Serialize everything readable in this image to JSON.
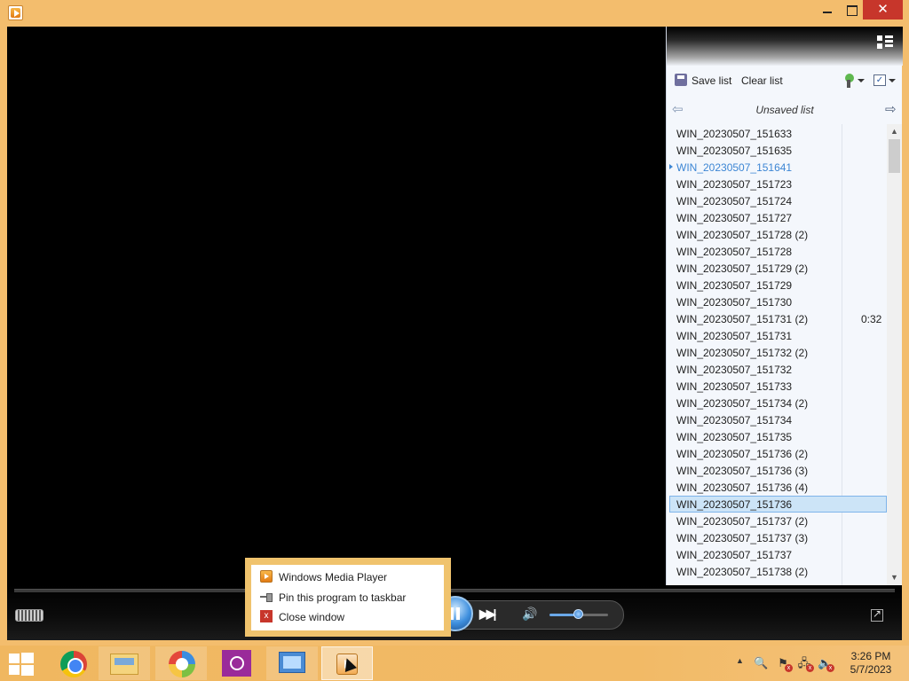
{
  "window": {
    "title": "",
    "icon": "windows-media-player-icon",
    "controls": {
      "minimize_icon": "minimize-icon",
      "maximize_icon": "maximize-icon",
      "close_glyph": "✕"
    }
  },
  "playlist": {
    "toolbar": {
      "save_label": "Save list",
      "clear_label": "Clear list"
    },
    "title": "Unsaved list",
    "nav": {
      "back_glyph": "⇦",
      "forward_glyph": "⇨"
    },
    "items": [
      {
        "name": "WIN_20230507_151633",
        "duration": ""
      },
      {
        "name": "WIN_20230507_151635",
        "duration": ""
      },
      {
        "name": "WIN_20230507_151641",
        "duration": "",
        "playing": true
      },
      {
        "name": "WIN_20230507_151723",
        "duration": ""
      },
      {
        "name": "WIN_20230507_151724",
        "duration": ""
      },
      {
        "name": "WIN_20230507_151727",
        "duration": ""
      },
      {
        "name": "WIN_20230507_151728 (2)",
        "duration": ""
      },
      {
        "name": "WIN_20230507_151728",
        "duration": ""
      },
      {
        "name": "WIN_20230507_151729 (2)",
        "duration": ""
      },
      {
        "name": "WIN_20230507_151729",
        "duration": ""
      },
      {
        "name": "WIN_20230507_151730",
        "duration": ""
      },
      {
        "name": "WIN_20230507_151731 (2)",
        "duration": "0:32"
      },
      {
        "name": "WIN_20230507_151731",
        "duration": ""
      },
      {
        "name": "WIN_20230507_151732 (2)",
        "duration": ""
      },
      {
        "name": "WIN_20230507_151732",
        "duration": ""
      },
      {
        "name": "WIN_20230507_151733",
        "duration": ""
      },
      {
        "name": "WIN_20230507_151734 (2)",
        "duration": ""
      },
      {
        "name": "WIN_20230507_151734",
        "duration": ""
      },
      {
        "name": "WIN_20230507_151735",
        "duration": ""
      },
      {
        "name": "WIN_20230507_151736 (2)",
        "duration": ""
      },
      {
        "name": "WIN_20230507_151736 (3)",
        "duration": ""
      },
      {
        "name": "WIN_20230507_151736 (4)",
        "duration": ""
      },
      {
        "name": "WIN_20230507_151736",
        "duration": "",
        "selected": true
      },
      {
        "name": "WIN_20230507_151737 (2)",
        "duration": ""
      },
      {
        "name": "WIN_20230507_151737 (3)",
        "duration": ""
      },
      {
        "name": "WIN_20230507_151737",
        "duration": ""
      },
      {
        "name": "WIN_20230507_151738 (2)",
        "duration": ""
      }
    ]
  },
  "player": {
    "state": "playing",
    "volume_fraction": 0.5
  },
  "jump_list": {
    "items": [
      {
        "label": "Windows Media Player",
        "icon": "windows-media-player-icon"
      },
      {
        "label": "Pin this program to taskbar",
        "icon": "pin-icon"
      },
      {
        "label": "Close window",
        "icon": "close-icon"
      }
    ]
  },
  "taskbar": {
    "apps": [
      "chrome-icon",
      "file-explorer-icon",
      "picasa-icon",
      "camera-icon",
      "remote-desktop-icon",
      "windows-media-player-icon"
    ],
    "clock": {
      "time": "3:26 PM",
      "date": "5/7/2023"
    }
  },
  "colors": {
    "accent": "#f3bd6d",
    "selection": "#cce4f7",
    "now_playing_text": "#3d86d4",
    "close_button": "#c7362b"
  }
}
